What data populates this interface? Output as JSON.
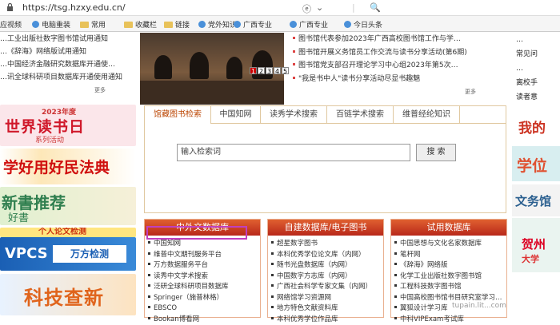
{
  "browser": {
    "url": "https://tsg.hzxy.edu.cn/",
    "tools": [
      "ⓔ",
      "⌄",
      "|",
      "🔍"
    ]
  },
  "bookmarks": [
    {
      "label": "应视频",
      "icon": "none"
    },
    {
      "label": "电脑重装",
      "icon": "globe"
    },
    {
      "label": "常用",
      "icon": "folder"
    },
    {
      "label": "收藏栏",
      "icon": "folder"
    },
    {
      "label": "链接",
      "icon": "folder"
    },
    {
      "label": "党外知识",
      "icon": "globe"
    },
    {
      "label": "广西专业",
      "icon": "globe"
    },
    {
      "label": "广西专业",
      "icon": "globe"
    },
    {
      "label": "今日头条",
      "icon": "globe"
    }
  ],
  "left_notices": [
    "…工业出版社数字图书馆试用通知",
    "…《辞海》网络版试用通知",
    "…中国经济金融研究数据库开通使…",
    "…讯全球科研项目数据库开通使用通知"
  ],
  "more_label": "更多",
  "slide_numbers": [
    "1",
    "2",
    "3",
    "4",
    "5"
  ],
  "news": [
    "图书馆代表参加2023年广西高校图书馆工作与学…",
    "图书馆开展义务馆员工作交流与读书分享活动(第6期)",
    "图书馆党支部召开理论学习中心组2023年第5次…",
    "\"我是书中人\"读书分享活动尽显书趣魅"
  ],
  "right_col": [
    "…",
    "常见问",
    "…",
    "离校手",
    "读者意"
  ],
  "left_banners": [
    {
      "line1": "2023年度",
      "line2": "世界读书日",
      "line3": "系列活动"
    },
    {
      "line1": "学好用好民法典"
    },
    {
      "line1": "新書推荐",
      "line2": "好書"
    },
    {
      "line1": "个人论文检测",
      "line2": "VPCS",
      "line3": "万方检测"
    },
    {
      "line1": "科技查新"
    }
  ],
  "right_banners": [
    "我的",
    "学位",
    "文务馆",
    "贺州",
    "大学"
  ],
  "search": {
    "tabs": [
      "馆藏图书检索",
      "中国知网",
      "读秀学术搜索",
      "百链学术搜索",
      "维普经纶知识"
    ],
    "placeholder": "输入检索词",
    "button": "搜 索"
  },
  "db_panels": [
    {
      "title": "中外文数据库",
      "items": [
        "中国知网",
        "维普中文期刊服务平台",
        "万方数据服务平台",
        "读秀中文学术搜索",
        "泛研全球科研项目数据库",
        "Springer（施普林格）",
        "EBSCO",
        "Bookan博看网"
      ]
    },
    {
      "title": "自建数据库/电子图书",
      "items": [
        "超星数字图书",
        "本科优秀学位论文库（内网）",
        "随书光盘数据库（内网）",
        "中国数字方志库（内网）",
        "广西社会科学专家文集（内网）",
        "网络馆学习资源网",
        "地方特色文献资料库",
        "本科优秀学位作品库"
      ]
    },
    {
      "title": "试用数据库",
      "items": [
        "中国思想与文化名家数据库",
        "笔杆网",
        "《辞海》网络版",
        "化学工业出版社数字图书馆",
        "工程科技数字图书馆",
        "中国高校图书馆书目研究室学习…",
        "翼狐设计学习库",
        "中科VIPExam考试库"
      ]
    }
  ],
  "watermark": "tupain.lit...com"
}
